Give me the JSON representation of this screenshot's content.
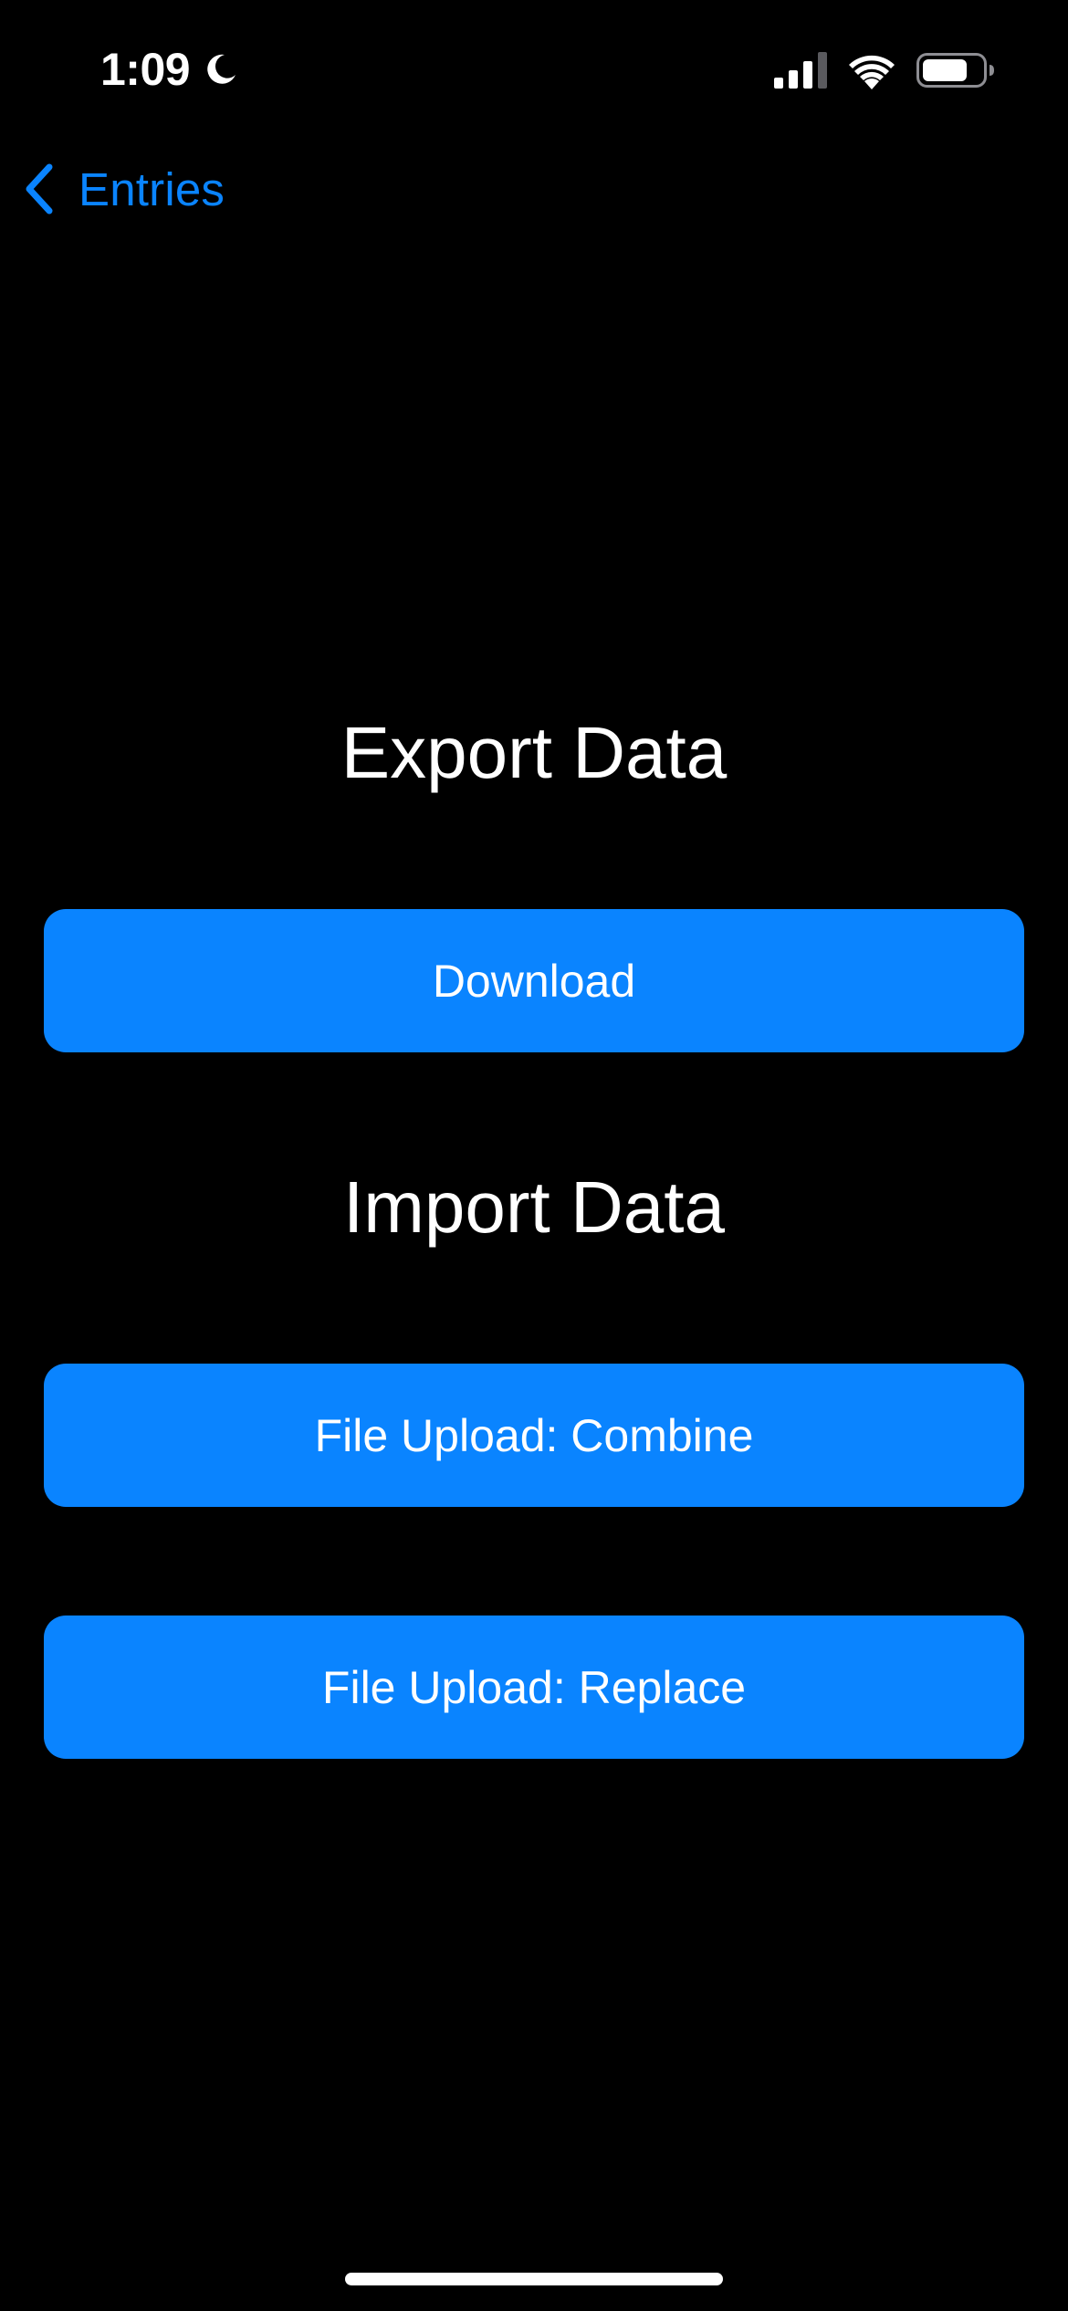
{
  "status_bar": {
    "time": "1:09",
    "focus_icon": "moon-icon",
    "signal_icon": "cellular-signal-icon",
    "wifi_icon": "wifi-icon",
    "battery_icon": "battery-icon",
    "battery_level": 0.75
  },
  "nav": {
    "back_label": "Entries",
    "back_icon": "chevron-left-icon"
  },
  "export": {
    "title": "Export Data",
    "download_label": "Download"
  },
  "import": {
    "title": "Import Data",
    "combine_label": "File Upload: Combine",
    "replace_label": "File Upload: Replace"
  },
  "colors": {
    "background": "#000000",
    "accent": "#0a84ff",
    "text": "#ffffff"
  }
}
